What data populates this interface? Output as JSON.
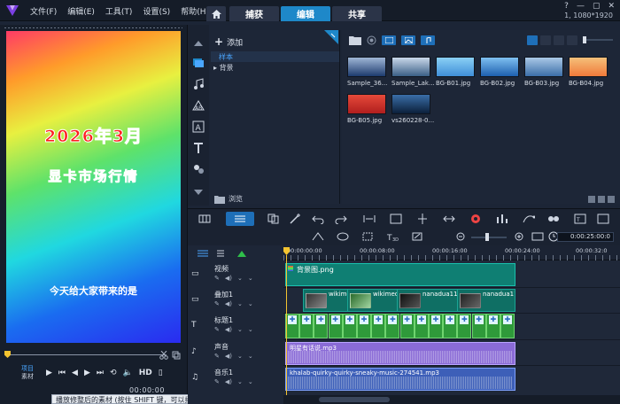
{
  "menu": [
    "文件(F)",
    "编辑(E)",
    "工具(T)",
    "设置(S)",
    "帮助(H)"
  ],
  "tabs": [
    {
      "label": "捕获",
      "active": false
    },
    {
      "label": "编辑",
      "active": true
    },
    {
      "label": "共享",
      "active": false
    }
  ],
  "resolution": "1, 1080*1920",
  "preview": {
    "line1": "2026年3月",
    "line2": "显卡市场行情",
    "line3": "今天给大家带来的是"
  },
  "playback": {
    "mode_project": "项目",
    "mode_clip": "素材",
    "hd": "HD",
    "timecode": "00:00:00",
    "tooltip": "播放修整后的素材 (按住 SHIFT 键，可以播放整个素材)"
  },
  "library": {
    "add_label": "添加",
    "tree": [
      "样本",
      "背景"
    ],
    "browse_label": "浏览",
    "thumbnails": [
      {
        "caption": "Sample_36...",
        "colors": [
          "#1d3b6e",
          "#9fb6d6"
        ]
      },
      {
        "caption": "Sample_Lak...",
        "colors": [
          "#3a5f86",
          "#c9d8ea"
        ]
      },
      {
        "caption": "BG-B01.jpg",
        "colors": [
          "#3f8ed8",
          "#8ad0f5"
        ]
      },
      {
        "caption": "BG-B02.jpg",
        "colors": [
          "#1d5fae",
          "#7fc0f0"
        ]
      },
      {
        "caption": "BG-B03.jpg",
        "colors": [
          "#3b6ea8",
          "#aac8e6"
        ]
      },
      {
        "caption": "BG-B04.jpg",
        "colors": [
          "#f07a3a",
          "#f5c07a"
        ]
      },
      {
        "caption": "BG-B05.jpg",
        "colors": [
          "#b01e1e",
          "#e64a3a"
        ]
      },
      {
        "caption": "vs260228-0...",
        "colors": [
          "#0b1f3a",
          "#3a6ea8"
        ]
      }
    ]
  },
  "timeline": {
    "timecode": "0:00:25:00:0",
    "ruler": [
      "00:00:00:00",
      "00:00:08:00",
      "00:00:16:00",
      "00:00:24:00",
      "00:00:32:0"
    ],
    "tracks": [
      {
        "name": "视频"
      },
      {
        "name": "叠加1"
      },
      {
        "name": "标题1"
      },
      {
        "name": "声音"
      },
      {
        "name": "音乐1"
      }
    ],
    "clips": {
      "video": "背景图.png",
      "overlay": [
        "wikimed",
        "wikimedi",
        "nanadua11-",
        "nanadua11"
      ],
      "voice": "明星有话说.mp3",
      "music": "khalab-quirky-quirky-sneaky-music-274541.mp3"
    }
  },
  "colors": {
    "accent": "#1e88c9",
    "video_clip": "#0f7f73",
    "title_clip": "#2f9a3a",
    "voice_clip": "#8a6bd6",
    "music_clip": "#3d5fb8",
    "playhead": "#f4c430"
  }
}
